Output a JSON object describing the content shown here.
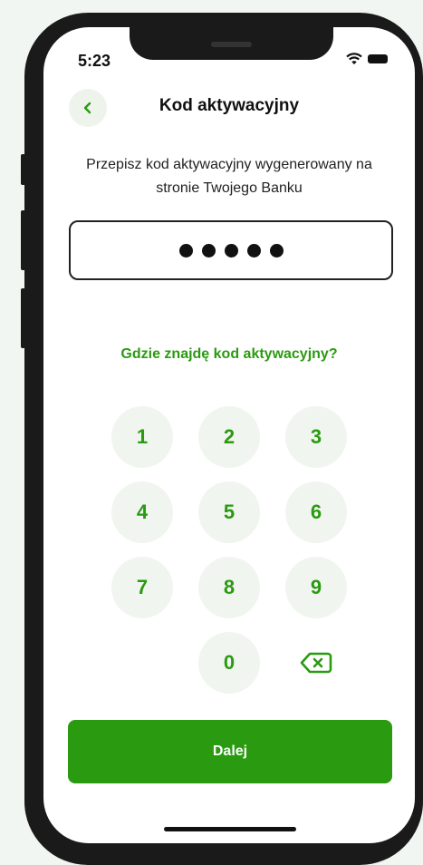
{
  "status_bar": {
    "time": "5:23"
  },
  "header": {
    "title": "Kod aktywacyjny"
  },
  "instructions": "Przepisz kod aktywacyjny wygenerowany na stronie Twojego Banku",
  "code_input": {
    "masked_length": 5
  },
  "help_link": "Gdzie znajdę kod aktywacyjny?",
  "keypad": {
    "keys": [
      "1",
      "2",
      "3",
      "4",
      "5",
      "6",
      "7",
      "8",
      "9",
      "0"
    ],
    "backspace_icon": "backspace-icon"
  },
  "primary_button": "Dalej",
  "colors": {
    "accent": "#2a9a10",
    "key_bg": "#f1f5ef",
    "back_btn_bg": "#eef3ec"
  }
}
